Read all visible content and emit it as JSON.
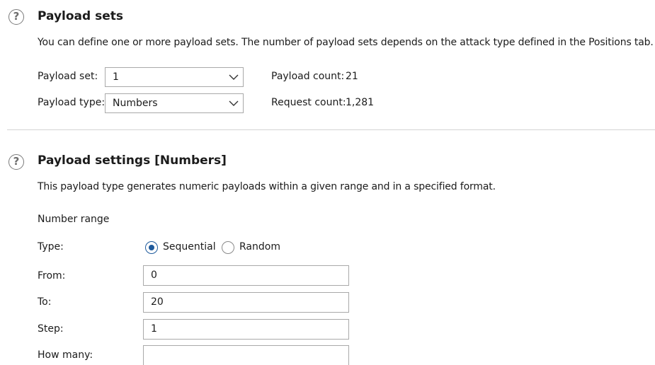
{
  "payload_sets": {
    "title": "Payload sets",
    "description": "You can define one or more payload sets. The number of payload sets depends on the attack type defined in the Positions tab. Vario",
    "payload_set_label": "Payload set:",
    "payload_set_value": "1",
    "payload_type_label": "Payload type:",
    "payload_type_value": "Numbers",
    "payload_count_label": "Payload count:",
    "payload_count_value": "21",
    "request_count_label": "Request count:",
    "request_count_value": "1,281"
  },
  "payload_settings": {
    "title": "Payload settings [Numbers]",
    "description": "This payload type generates numeric payloads within a given range and in a specified format.",
    "number_range_label": "Number range",
    "type_label": "Type:",
    "type_options": [
      {
        "label": "Sequential",
        "selected": true
      },
      {
        "label": "Random",
        "selected": false
      }
    ],
    "from_label": "From:",
    "from_value": "0",
    "to_label": "To:",
    "to_value": "20",
    "step_label": "Step:",
    "step_value": "1",
    "how_many_label": "How many:",
    "how_many_value": ""
  },
  "icons": {
    "help": "?",
    "accent_color": "#1e5a9c"
  }
}
